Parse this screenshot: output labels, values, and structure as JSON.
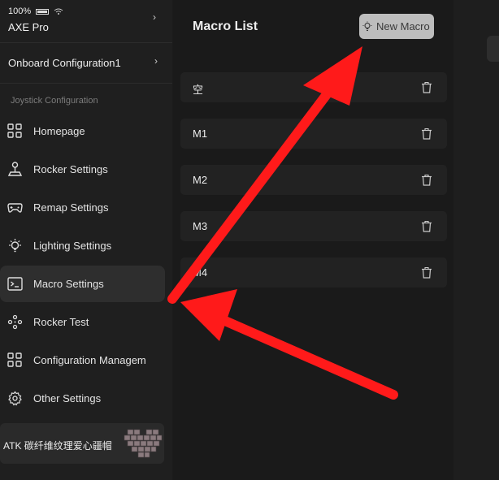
{
  "status": {
    "battery": "100%"
  },
  "device": {
    "name": "AXE Pro",
    "chevron": "›"
  },
  "onboard": {
    "label": "Onboard Configuration1",
    "chevron": "›"
  },
  "sidebar": {
    "section_title": "Joystick Configuration",
    "items": [
      {
        "label": "Homepage",
        "icon": "grid-icon"
      },
      {
        "label": "Rocker Settings",
        "icon": "joystick-icon"
      },
      {
        "label": "Remap Settings",
        "icon": "gamepad-icon"
      },
      {
        "label": "Lighting Settings",
        "icon": "lightbulb-icon"
      },
      {
        "label": "Macro Settings",
        "icon": "terminal-icon",
        "active": true
      },
      {
        "label": "Rocker Test",
        "icon": "dpad-icon"
      },
      {
        "label": "Configuration Managem",
        "icon": "grid-icon"
      },
      {
        "label": "Other Settings",
        "icon": "gear-icon"
      }
    ]
  },
  "profile": {
    "name": "ATK 碳纤维纹理爱心疆帽"
  },
  "main": {
    "title": "Macro List",
    "new_macro_label": "New Macro",
    "macros": [
      {
        "name": "空"
      },
      {
        "name": "M1"
      },
      {
        "name": "M2"
      },
      {
        "name": "M3"
      },
      {
        "name": "M4"
      }
    ]
  },
  "colors": {
    "accent_arrow": "#ff1a1a",
    "active_item": "#2e2e2e",
    "button_bg": "#bdbdbd"
  }
}
